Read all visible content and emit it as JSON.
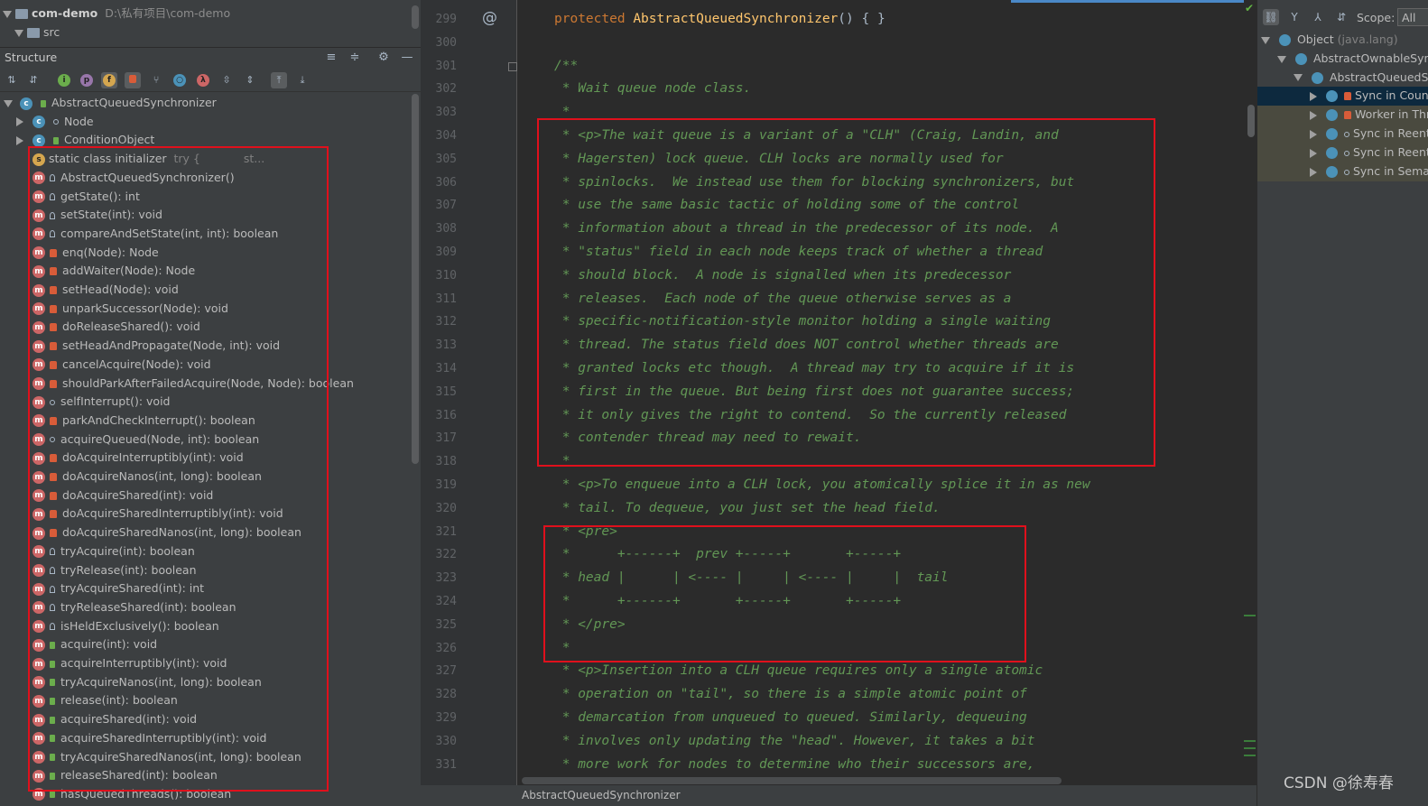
{
  "project": {
    "root_name": "com-demo",
    "root_path": "D:\\私有项目\\com-demo",
    "src_label": "src"
  },
  "structure": {
    "title": "Structure",
    "class_name": "AbstractQueuedSynchronizer",
    "nested": [
      {
        "label": "Node"
      },
      {
        "label": "ConditionObject"
      }
    ],
    "static_initializer": {
      "label": "static class initializer",
      "hint": "try {",
      "hint2": "st..."
    },
    "methods": [
      {
        "label": "AbstractQueuedSynchronizer()",
        "vis": "prot"
      },
      {
        "label": "getState(): int",
        "vis": "prot"
      },
      {
        "label": "setState(int): void",
        "vis": "prot"
      },
      {
        "label": "compareAndSetState(int, int): boolean",
        "vis": "prot"
      },
      {
        "label": "enq(Node): Node",
        "vis": "priv"
      },
      {
        "label": "addWaiter(Node): Node",
        "vis": "priv"
      },
      {
        "label": "setHead(Node): void",
        "vis": "priv"
      },
      {
        "label": "unparkSuccessor(Node): void",
        "vis": "priv"
      },
      {
        "label": "doReleaseShared(): void",
        "vis": "priv"
      },
      {
        "label": "setHeadAndPropagate(Node, int): void",
        "vis": "priv"
      },
      {
        "label": "cancelAcquire(Node): void",
        "vis": "priv"
      },
      {
        "label": "shouldParkAfterFailedAcquire(Node, Node): boolean",
        "vis": "priv"
      },
      {
        "label": "selfInterrupt(): void",
        "vis": "pkg"
      },
      {
        "label": "parkAndCheckInterrupt(): boolean",
        "vis": "priv"
      },
      {
        "label": "acquireQueued(Node, int): boolean",
        "vis": "pkg"
      },
      {
        "label": "doAcquireInterruptibly(int): void",
        "vis": "priv"
      },
      {
        "label": "doAcquireNanos(int, long): boolean",
        "vis": "priv"
      },
      {
        "label": "doAcquireShared(int): void",
        "vis": "priv"
      },
      {
        "label": "doAcquireSharedInterruptibly(int): void",
        "vis": "priv"
      },
      {
        "label": "doAcquireSharedNanos(int, long): boolean",
        "vis": "priv"
      },
      {
        "label": "tryAcquire(int): boolean",
        "vis": "prot"
      },
      {
        "label": "tryRelease(int): boolean",
        "vis": "prot"
      },
      {
        "label": "tryAcquireShared(int): int",
        "vis": "prot"
      },
      {
        "label": "tryReleaseShared(int): boolean",
        "vis": "prot"
      },
      {
        "label": "isHeldExclusively(): boolean",
        "vis": "prot"
      },
      {
        "label": "acquire(int): void",
        "vis": "pub"
      },
      {
        "label": "acquireInterruptibly(int): void",
        "vis": "pub"
      },
      {
        "label": "tryAcquireNanos(int, long): boolean",
        "vis": "pub"
      },
      {
        "label": "release(int): boolean",
        "vis": "pub"
      },
      {
        "label": "acquireShared(int): void",
        "vis": "pub"
      },
      {
        "label": "acquireSharedInterruptibly(int): void",
        "vis": "pub"
      },
      {
        "label": "tryAcquireSharedNanos(int, long): boolean",
        "vis": "pub"
      },
      {
        "label": "releaseShared(int): boolean",
        "vis": "pub"
      },
      {
        "label": "hasQueuedThreads(): boolean",
        "vis": "pub"
      }
    ]
  },
  "editor": {
    "lines": [
      {
        "n": "299",
        "segs": [
          [
            "kw",
            "protected "
          ],
          [
            "fn",
            "AbstractQueuedSynchronizer"
          ],
          [
            "pl",
            "() { }"
          ]
        ]
      },
      {
        "n": "300",
        "segs": []
      },
      {
        "n": "301",
        "segs": [
          [
            "cmt",
            "/**"
          ]
        ]
      },
      {
        "n": "302",
        "segs": [
          [
            "cmt",
            " * Wait queue node class."
          ]
        ]
      },
      {
        "n": "303",
        "segs": [
          [
            "cmt",
            " *"
          ]
        ]
      },
      {
        "n": "304",
        "segs": [
          [
            "cmt",
            " * <p>The wait queue is a variant of a \"CLH\" (Craig, Landin, and"
          ]
        ]
      },
      {
        "n": "305",
        "segs": [
          [
            "cmt",
            " * Hagersten) lock queue. CLH locks are normally used for"
          ]
        ]
      },
      {
        "n": "306",
        "segs": [
          [
            "cmt",
            " * spinlocks.  We instead use them for blocking synchronizers, but"
          ]
        ]
      },
      {
        "n": "307",
        "segs": [
          [
            "cmt",
            " * use the same basic tactic of holding some of the control"
          ]
        ]
      },
      {
        "n": "308",
        "segs": [
          [
            "cmt",
            " * information about a thread in the predecessor of its node.  A"
          ]
        ]
      },
      {
        "n": "309",
        "segs": [
          [
            "cmt",
            " * \"status\" field in each node keeps track of whether a thread"
          ]
        ]
      },
      {
        "n": "310",
        "segs": [
          [
            "cmt",
            " * should block.  A node is signalled when its predecessor"
          ]
        ]
      },
      {
        "n": "311",
        "segs": [
          [
            "cmt",
            " * releases.  Each node of the queue otherwise serves as a"
          ]
        ]
      },
      {
        "n": "312",
        "segs": [
          [
            "cmt",
            " * specific-notification-style monitor holding a single waiting"
          ]
        ]
      },
      {
        "n": "313",
        "segs": [
          [
            "cmt",
            " * thread. The status field does NOT control whether threads are"
          ]
        ]
      },
      {
        "n": "314",
        "segs": [
          [
            "cmt",
            " * granted locks etc though.  A thread may try to acquire if it is"
          ]
        ]
      },
      {
        "n": "315",
        "segs": [
          [
            "cmt",
            " * first in the queue. But being first does not guarantee success;"
          ]
        ]
      },
      {
        "n": "316",
        "segs": [
          [
            "cmt",
            " * it only gives the right to contend.  So the currently released"
          ]
        ]
      },
      {
        "n": "317",
        "segs": [
          [
            "cmt",
            " * contender thread may need to rewait."
          ]
        ]
      },
      {
        "n": "318",
        "segs": [
          [
            "cmt",
            " *"
          ]
        ]
      },
      {
        "n": "319",
        "segs": [
          [
            "cmt",
            " * <p>To enqueue into a CLH lock, you atomically splice it in as new"
          ]
        ]
      },
      {
        "n": "320",
        "segs": [
          [
            "cmt",
            " * tail. To dequeue, you just set the head field."
          ]
        ]
      },
      {
        "n": "321",
        "segs": [
          [
            "cmt",
            " * <pre>"
          ]
        ]
      },
      {
        "n": "322",
        "segs": [
          [
            "cmt",
            " *      +------+  prev +-----+       +-----+"
          ]
        ]
      },
      {
        "n": "323",
        "segs": [
          [
            "cmt",
            " * head |      | <---- |     | <---- |     |  tail"
          ]
        ]
      },
      {
        "n": "324",
        "segs": [
          [
            "cmt",
            " *      +------+       +-----+       +-----+"
          ]
        ]
      },
      {
        "n": "325",
        "segs": [
          [
            "cmt",
            " * </pre>"
          ]
        ]
      },
      {
        "n": "326",
        "segs": [
          [
            "cmt",
            " *"
          ]
        ]
      },
      {
        "n": "327",
        "segs": [
          [
            "cmt",
            " * <p>Insertion into a CLH queue requires only a single atomic"
          ]
        ]
      },
      {
        "n": "328",
        "segs": [
          [
            "cmt",
            " * operation on \"tail\", so there is a simple atomic point of"
          ]
        ]
      },
      {
        "n": "329",
        "segs": [
          [
            "cmt",
            " * demarcation from unqueued to queued. Similarly, dequeuing"
          ]
        ]
      },
      {
        "n": "330",
        "segs": [
          [
            "cmt",
            " * involves only updating the \"head\". However, it takes a bit"
          ]
        ]
      },
      {
        "n": "331",
        "segs": [
          [
            "cmt",
            " * more work for nodes to determine who their successors are,"
          ]
        ]
      }
    ],
    "breadcrumb": "AbstractQueuedSynchronizer"
  },
  "hierarchy": {
    "scope_label": "Scope:",
    "scope_value": "All",
    "items": [
      {
        "label": "Object",
        "sub": "(java.lang)"
      },
      {
        "label": "AbstractOwnableSynchronizer",
        "sub": ""
      },
      {
        "label": "AbstractQueuedSynchronizer",
        "sub": ""
      },
      {
        "label": "Sync in CountDownLatch",
        "sub": ""
      },
      {
        "label": "Worker in ThreadPoolExecutor",
        "sub": ""
      },
      {
        "label": "Sync in ReentrantLock",
        "sub": ""
      },
      {
        "label": "Sync in ReentrantReadWriteLock",
        "sub": ""
      },
      {
        "label": "Sync in Semaphore",
        "sub": ""
      }
    ]
  },
  "watermark": "CSDN @徐寿春",
  "colors": {
    "highlight_box": "#e0101c",
    "comment": "#629755",
    "keyword": "#cc7832",
    "method_name": "#ffc66d"
  }
}
